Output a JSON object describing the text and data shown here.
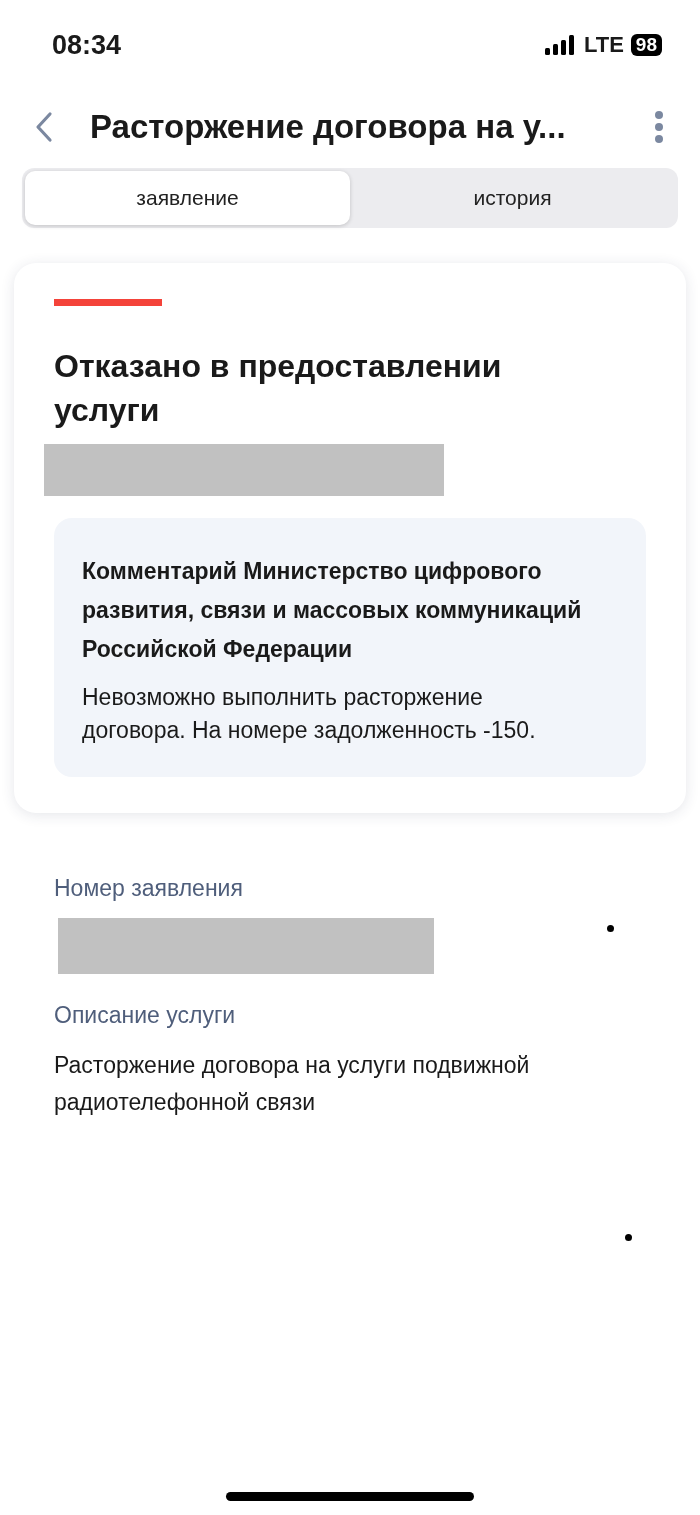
{
  "status_bar": {
    "time": "08:34",
    "network": "LTE",
    "battery": "98"
  },
  "header": {
    "title": "Расторжение договора на у..."
  },
  "tabs": [
    {
      "label": "заявление",
      "selected": true
    },
    {
      "label": "история",
      "selected": false
    }
  ],
  "status_card": {
    "status": "Отказано в предоставлении услуги",
    "comment_title": "Комментарий Министерство цифрового развития, связи и массовых коммуникаций Российской Федерации",
    "comment_text": "Невозможно выполнить расторжение договора. На номере задолженность -150."
  },
  "details": [
    {
      "label": "Номер заявления",
      "redacted": true
    },
    {
      "label": "Описание услуги",
      "value": "Расторжение договора на услуги подвижной радиотелефонной связи",
      "redacted": false
    }
  ]
}
